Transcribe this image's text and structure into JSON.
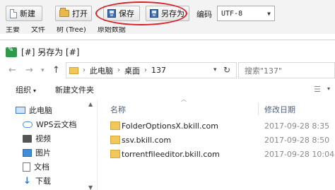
{
  "editor": {
    "toolbar": {
      "new_label": "新建",
      "open_label": "打开",
      "save_label": "保存",
      "save_as_label": "另存为",
      "encoding_label": "编码",
      "encoding_value": "UTF-8"
    },
    "tabs": [
      "主要",
      "文件",
      "树 (Tree)",
      "原始数据"
    ],
    "highlight_color": "#d9222a"
  },
  "dialog": {
    "title": "[#] 另存为 [#]",
    "address": {
      "segments": [
        "此电脑",
        "桌面",
        "137"
      ]
    },
    "search_placeholder": "搜索\"137\"",
    "commands": {
      "organize": "组织",
      "new_folder": "新建文件夹"
    },
    "nav_items": [
      {
        "icon": "computer-icon",
        "label": "此电脑"
      },
      {
        "icon": "cloud-icon",
        "label": "WPS云文档"
      },
      {
        "icon": "video-icon",
        "label": "视频"
      },
      {
        "icon": "picture-icon",
        "label": "图片"
      },
      {
        "icon": "document-icon",
        "label": "文档"
      },
      {
        "icon": "download-icon",
        "label": "下载"
      }
    ],
    "columns": {
      "name": "名称",
      "modified": "修改日期"
    },
    "files": [
      {
        "name": "FolderOptionsX.bkill.com",
        "modified": "2017-09-28 8:35"
      },
      {
        "name": "ssv.bkill.com",
        "modified": "2017-09-28 8:50"
      },
      {
        "name": "torrentfileeditor.bkill.com",
        "modified": "2017-09-28 10:04"
      }
    ]
  }
}
